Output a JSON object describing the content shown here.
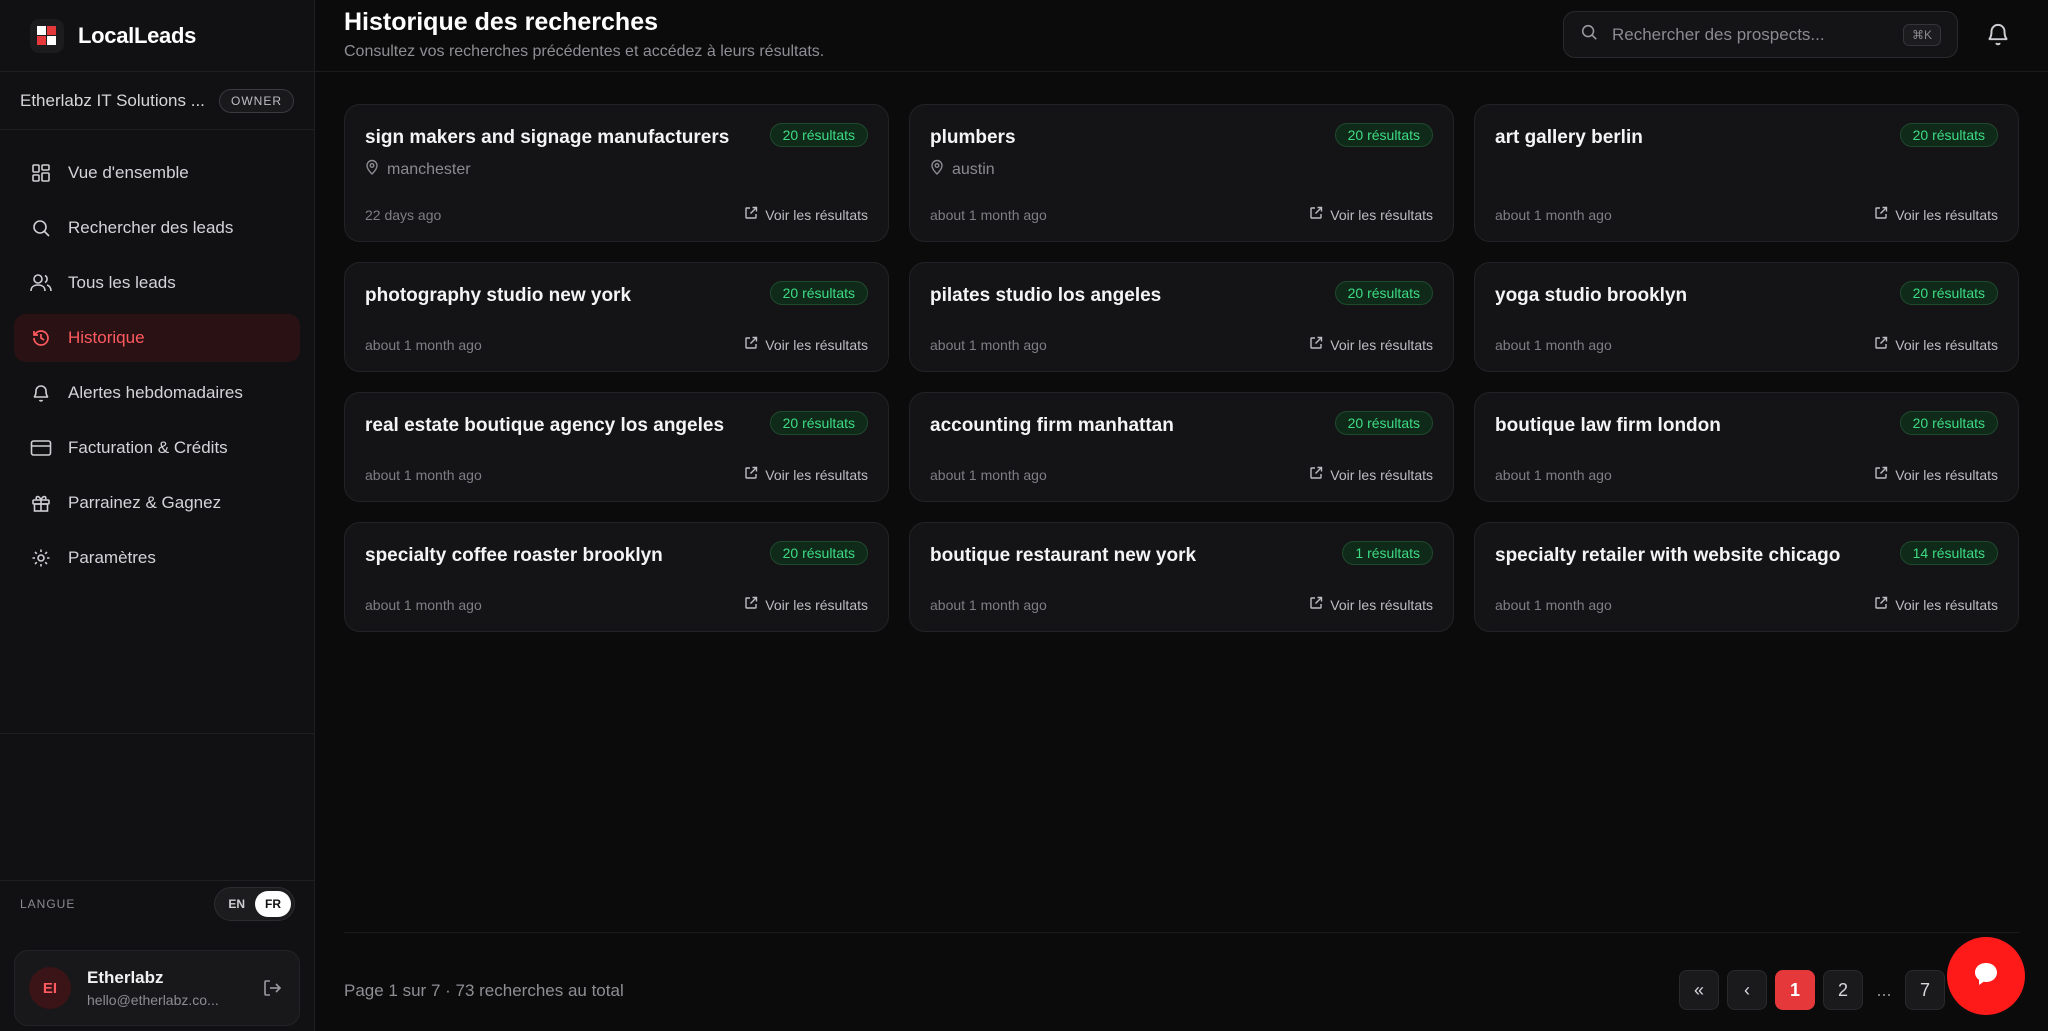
{
  "brand": {
    "name": "LocalLeads"
  },
  "workspace": {
    "name": "Etherlabz IT Solutions ...",
    "role": "OWNER"
  },
  "nav": [
    {
      "label": "Vue d'ensemble",
      "icon": "dashboard-icon"
    },
    {
      "label": "Rechercher des leads",
      "icon": "search-icon"
    },
    {
      "label": "Tous les leads",
      "icon": "users-icon"
    },
    {
      "label": "Historique",
      "icon": "history-icon",
      "active": true
    },
    {
      "label": "Alertes hebdomadaires",
      "icon": "bell-icon"
    },
    {
      "label": "Facturation & Crédits",
      "icon": "credit-card-icon"
    },
    {
      "label": "Parrainez & Gagnez",
      "icon": "gift-icon"
    },
    {
      "label": "Paramètres",
      "icon": "gear-icon"
    }
  ],
  "language": {
    "label": "LANGUE",
    "options": [
      "EN",
      "FR"
    ],
    "selected": "FR"
  },
  "user": {
    "initials": "EI",
    "name": "Etherlabz",
    "email": "hello@etherlabz.co..."
  },
  "header": {
    "title": "Historique des recherches",
    "subtitle": "Consultez vos recherches précédentes et accédez à leurs résultats.",
    "search_placeholder": "Rechercher des prospects...",
    "shortcut": "⌘K"
  },
  "cards": [
    {
      "title": "sign makers and signage manufacturers",
      "badge": "20 résultats",
      "location": "manchester",
      "time": "22 days ago",
      "link": "Voir les résultats"
    },
    {
      "title": "plumbers",
      "badge": "20 résultats",
      "location": "austin",
      "time": "about 1 month ago",
      "link": "Voir les résultats"
    },
    {
      "title": "art gallery berlin",
      "badge": "20 résultats",
      "location": "",
      "time": "about 1 month ago",
      "link": "Voir les résultats"
    },
    {
      "title": "photography studio new york",
      "badge": "20 résultats",
      "location": "",
      "time": "about 1 month ago",
      "link": "Voir les résultats"
    },
    {
      "title": "pilates studio los angeles",
      "badge": "20 résultats",
      "location": "",
      "time": "about 1 month ago",
      "link": "Voir les résultats"
    },
    {
      "title": "yoga studio brooklyn",
      "badge": "20 résultats",
      "location": "",
      "time": "about 1 month ago",
      "link": "Voir les résultats"
    },
    {
      "title": "real estate boutique agency los angeles",
      "badge": "20 résultats",
      "location": "",
      "time": "about 1 month ago",
      "link": "Voir les résultats"
    },
    {
      "title": "accounting firm manhattan",
      "badge": "20 résultats",
      "location": "",
      "time": "about 1 month ago",
      "link": "Voir les résultats"
    },
    {
      "title": "boutique law firm london",
      "badge": "20 résultats",
      "location": "",
      "time": "about 1 month ago",
      "link": "Voir les résultats"
    },
    {
      "title": "specialty coffee roaster brooklyn",
      "badge": "20 résultats",
      "location": "",
      "time": "about 1 month ago",
      "link": "Voir les résultats"
    },
    {
      "title": "boutique restaurant new york",
      "badge": "1 résultats",
      "location": "",
      "time": "about 1 month ago",
      "link": "Voir les résultats"
    },
    {
      "title": "specialty retailer with website chicago",
      "badge": "14 résultats",
      "location": "",
      "time": "about 1 month ago",
      "link": "Voir les résultats"
    }
  ],
  "pagination": {
    "info": "Page 1 sur 7 · 73 recherches au total",
    "first": "«",
    "prev": "‹",
    "pages": [
      "1",
      "2"
    ],
    "ellipsis": "...",
    "last_page": "7",
    "current": "1"
  },
  "colors": {
    "accent": "#e5383b",
    "success": "#3ddc84",
    "background": "#0b0b0c"
  }
}
